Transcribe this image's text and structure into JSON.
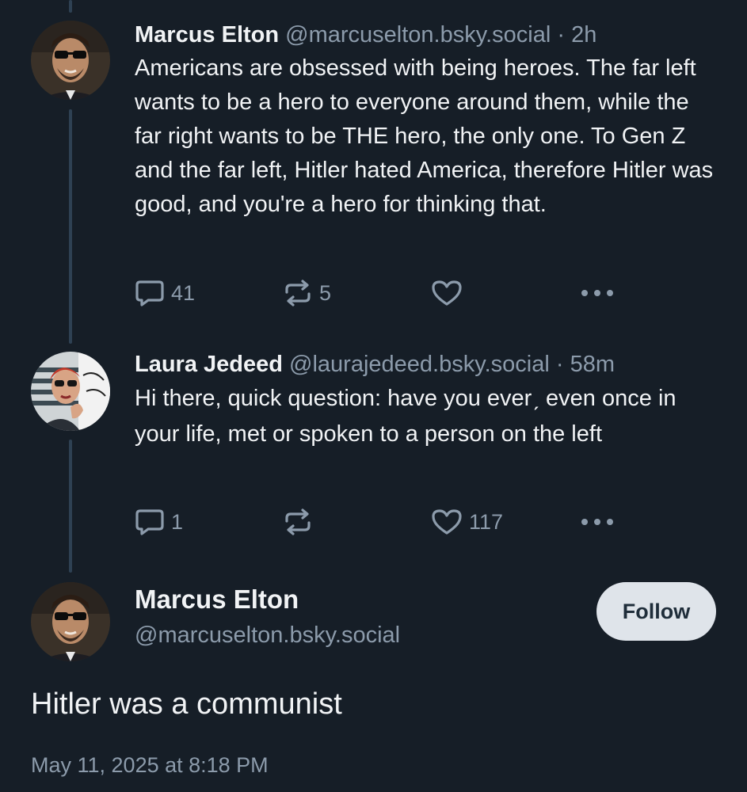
{
  "posts": [
    {
      "author": "Marcus Elton",
      "handle": "@marcuselton.bsky.social",
      "separator": "·",
      "time": "2h",
      "text": "Americans are obsessed with being heroes. The far left wants to be a hero to everyone around them, while the far right wants to be THE hero, the only one. To Gen Z and the far left, Hitler hated America, therefore Hitler was good, and you're a hero for thinking that.",
      "replies": "41",
      "reposts": "5",
      "likes": ""
    },
    {
      "author": "Laura Jedeed",
      "handle": "@laurajedeed.bsky.social",
      "separator": "·",
      "time": "58m",
      "text": "Hi there, quick question: have you everˏ even once in your life, met or spoken to a person on the left",
      "replies": "1",
      "reposts": "",
      "likes": "117"
    }
  ],
  "main_post": {
    "author": "Marcus Elton",
    "handle": "@marcuselton.bsky.social",
    "follow_label": "Follow",
    "text": "Hitler was a communist",
    "timestamp": "May 11, 2025 at 8:18 PM"
  },
  "icons": {
    "reply": "reply-icon",
    "repost": "repost-icon",
    "like": "heart-icon",
    "more": "more-icon"
  },
  "colors": {
    "background": "#161e27",
    "text": "#f1f3f5",
    "muted": "#8c9bab",
    "thread_line": "#2e4153",
    "follow_bg": "#dfe4ea"
  }
}
